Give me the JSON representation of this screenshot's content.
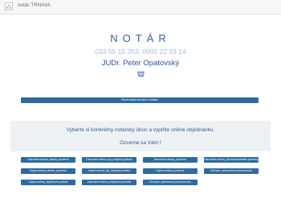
{
  "topbar": {
    "title": "notár TRNAVA"
  },
  "brand": {
    "name": "NOTÁR",
    "phone": "033 55 15 353, 0905 22 33 14",
    "person": "JUDr. Peter Opatovský"
  },
  "reserve_button": "Rezervácia termínu u notára",
  "info": {
    "line1": "Vyberte si konkrétny notársky úkon a vyplňte online objednávku.",
    "line2": "Ozveme sa Vám !"
  },
  "services": [
    "Darovacia zmluva_stavba_pozemok",
    "Darovacia zmluva_byt_nebytový priestor",
    "Darovacia zmluva_pozemok",
    "Darovacia zmluva_poľnohospodárske pozemky",
    "Kúpna zmluva_stavba_pozemok",
    "Kúpna zmluva_byt_nebytový priestor",
    "Kúpna zmluva_pozemok",
    "Dohoda o preneseniu práva prevodu",
    "Kúpna zmluva_doplnkové pravidlá",
    "Darovacia zmluva_doplnkové pravidlá",
    "Dohoda o preneseniu práva prevodu"
  ]
}
